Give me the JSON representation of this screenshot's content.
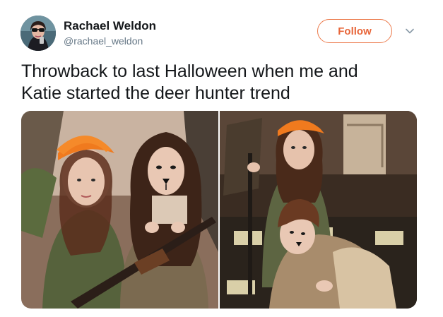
{
  "user": {
    "display_name": "Rachael Weldon",
    "handle": "@rachael_weldon",
    "avatar_icon": "profile-photo"
  },
  "actions": {
    "follow_label": "Follow",
    "menu_icon": "chevron-down-icon"
  },
  "tweet": {
    "text_line1": "Throwback to last Halloween when me and",
    "text_line2": "Katie started the deer hunter trend"
  },
  "media": {
    "photos": [
      {
        "name": "photo-two-girls-costumes"
      },
      {
        "name": "photo-hunter-and-deer-pose"
      }
    ]
  },
  "colors": {
    "follow_accent": "#e8663a",
    "handle_gray": "#657786",
    "text": "#14171a"
  }
}
